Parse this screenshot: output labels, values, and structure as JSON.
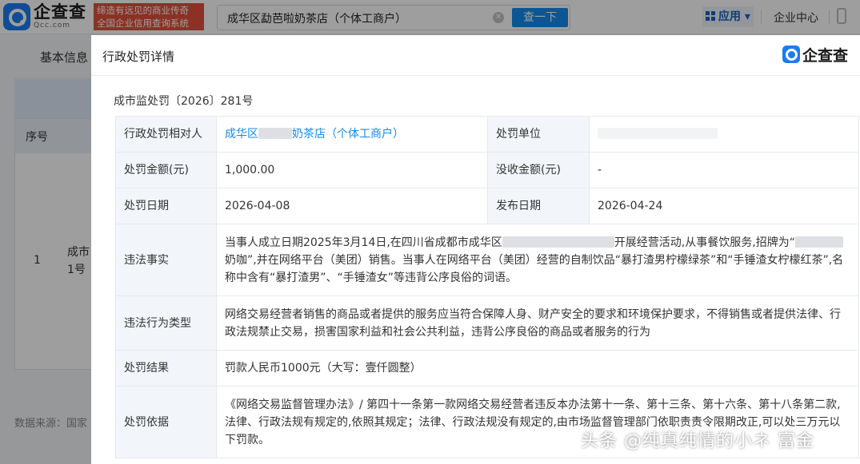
{
  "header": {
    "logo_cn": "企查查",
    "logo_en": "Qcc.com",
    "slogan_line1": "缔造有远见的商业传奇",
    "slogan_line2": "全国企业信用查询系统",
    "search_value": "成华区勐芭啦奶茶店（个体工商户）",
    "search_button": "查一下",
    "app_label": "应用",
    "enterprise_center": "企业中心"
  },
  "background": {
    "tab": "基本信息",
    "col_index": "序号",
    "row_index": "1",
    "row_name_line1": "成市",
    "row_name_line2": "1号",
    "source": "数据来源：国家"
  },
  "modal": {
    "title": "行政处罚详情",
    "logo_text": "企查查",
    "case_no": "成市监处罚〔2026〕281号",
    "rows": {
      "party_key": "行政处罚相对人",
      "party_prefix": "成华区",
      "party_suffix": "奶茶店（个体工商户）",
      "unit_key": "处罚单位",
      "amount_key": "处罚金额(元)",
      "amount_val": "1,000.00",
      "confiscate_key": "没收金额(元)",
      "confiscate_val": "-",
      "date_key": "处罚日期",
      "date_val": "2026-04-08",
      "publish_key": "发布日期",
      "publish_val": "2026-04-24",
      "facts_key": "违法事实",
      "facts_part1": "当事人成立日期2025年3月14日,在四川省成都市成华区",
      "facts_part2": "开展经营活动,从事餐饮服务,招牌为“",
      "facts_part3": "奶咖”,并在网络平台（美团）销售。当事人在网络平台（美团）经营的自制饮品“暴打渣男柠檬绿茶”和“手锤渣女柠檬红茶”,名称中含有“暴打渣男”、“手锤渣女”等违背公序良俗的词语。",
      "type_key": "违法行为类型",
      "type_val": "网络交易经营者销售的商品或者提供的服务应当符合保障人身、财产安全的要求和环境保护要求，不得销售或者提供法律、行政法规禁止交易，损害国家利益和社会公共利益，违背公序良俗的商品或者服务的行为",
      "result_key": "处罚结果",
      "result_val": "罚款人民币1000元（大写：壹仟圆整）",
      "basis_key": "处罚依据",
      "basis_val": "《网络交易监督管理办法》/ 第四十一条第一款网络交易经营者违反本办法第十一条、第十三条、第十六条、第十八条第二款,法律、行政法规有规定的,依照其规定；法律、行政法规没有规定的,由市场监督管理部门依职责责令限期改正,可以处三万元以下罚款。"
    }
  },
  "watermark": "头条 @纯真纯情的小ネ 富金"
}
